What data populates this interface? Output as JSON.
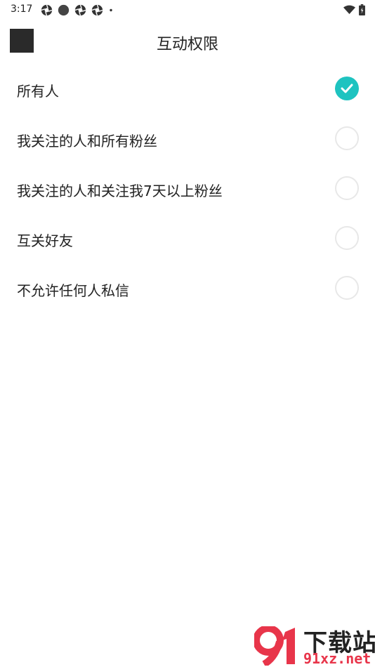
{
  "status_bar": {
    "time": "3:17"
  },
  "header": {
    "title": "互动权限"
  },
  "options": [
    {
      "label": "所有人",
      "selected": true
    },
    {
      "label": "我关注的人和所有粉丝",
      "selected": false
    },
    {
      "label": "我关注的人和关注我7天以上粉丝",
      "selected": false
    },
    {
      "label": "互关好友",
      "selected": false
    },
    {
      "label": "不允许任何人私信",
      "selected": false
    }
  ],
  "watermark": {
    "logo_text": "91",
    "title": "下载站",
    "url": "91xz.net"
  },
  "colors": {
    "accent": "#1ec3c0",
    "radio_border": "#e8e8e8",
    "watermark_red": "#e8354a"
  }
}
